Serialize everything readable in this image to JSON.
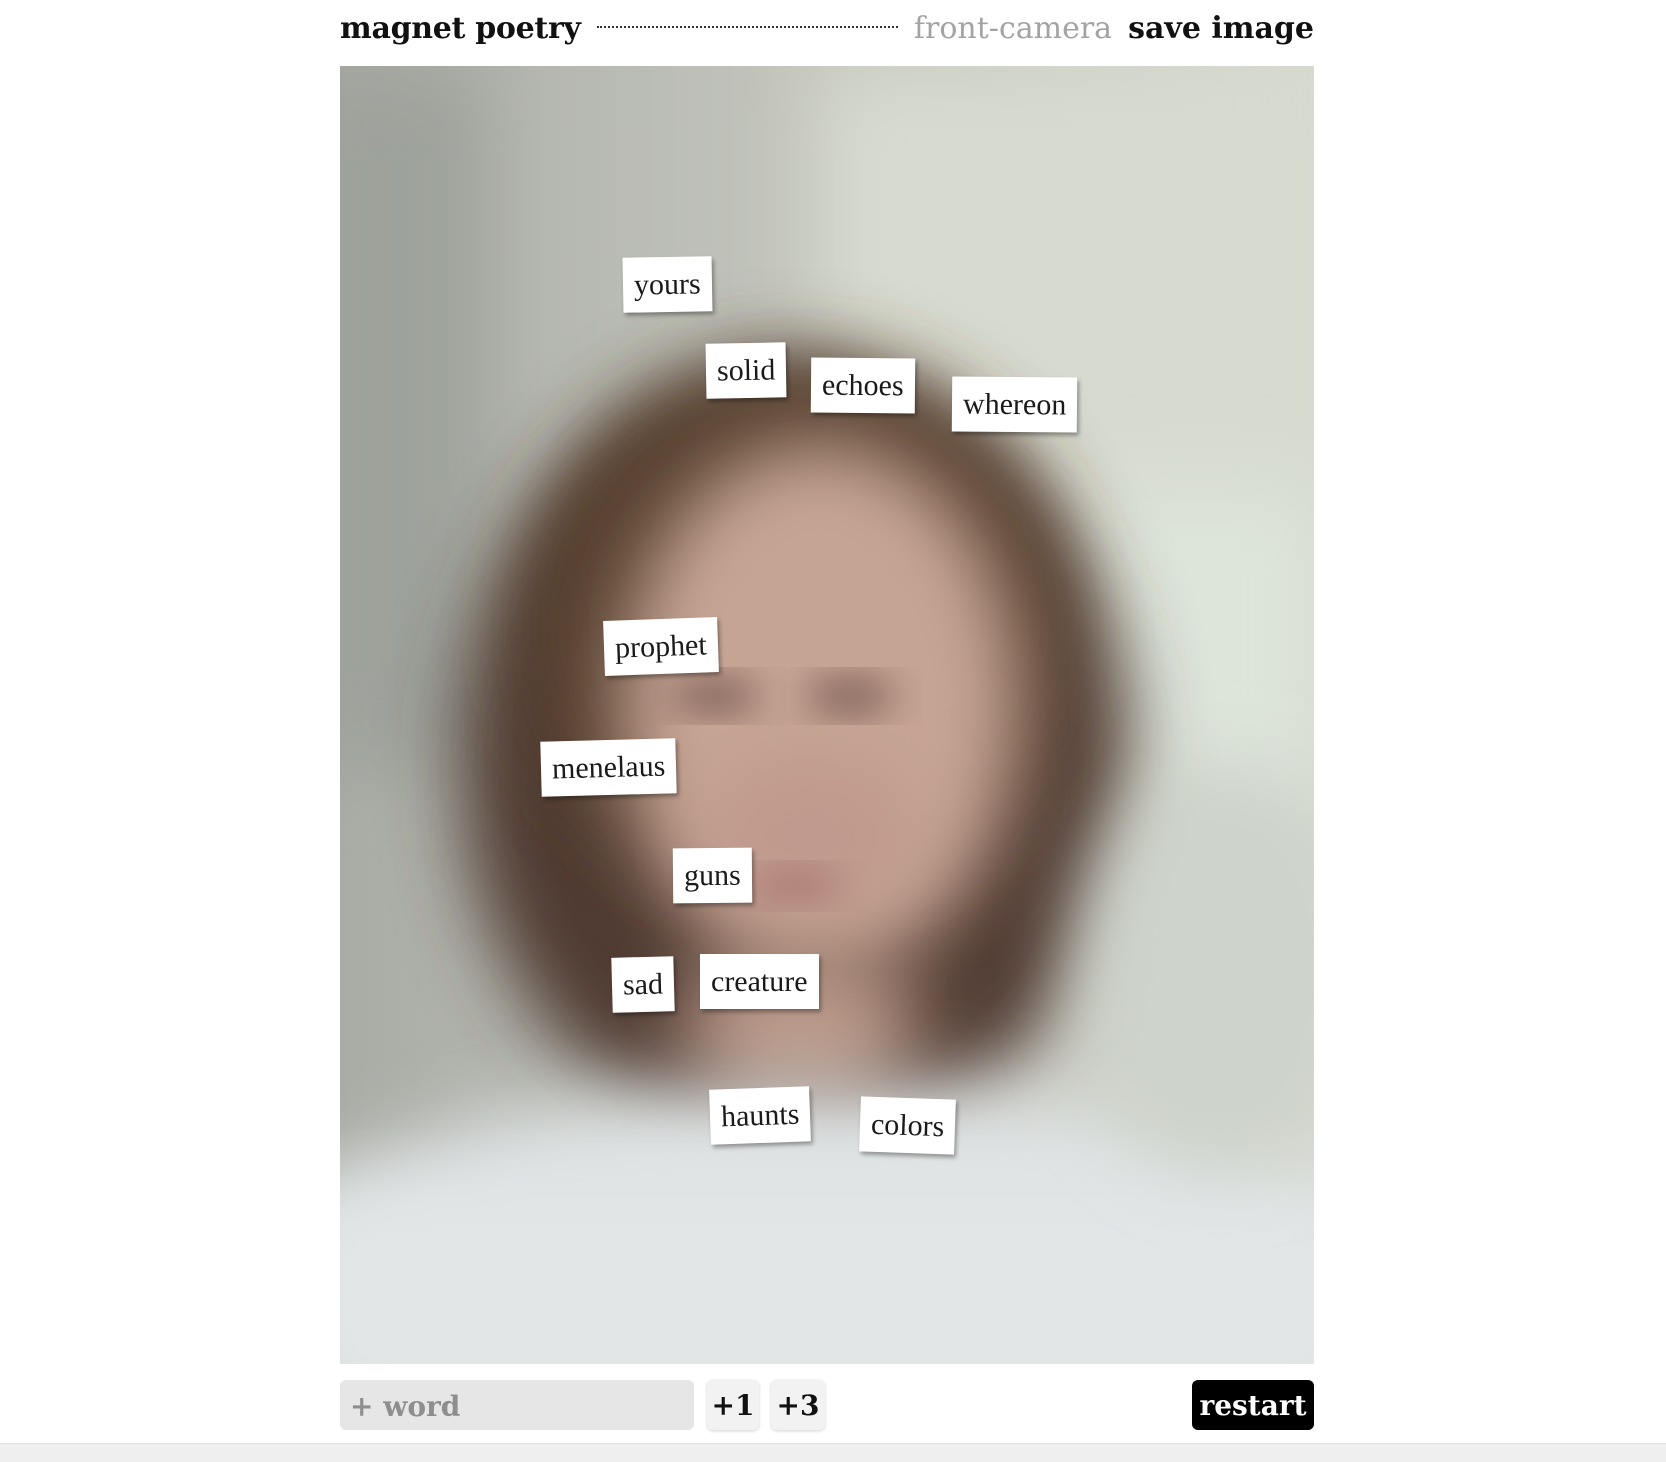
{
  "header": {
    "title": "magnet poetry",
    "camera_label": "front-camera",
    "save_label": "save image"
  },
  "tiles": [
    {
      "word": "yours"
    },
    {
      "word": "solid"
    },
    {
      "word": "echoes"
    },
    {
      "word": "whereon"
    },
    {
      "word": "prophet"
    },
    {
      "word": "menelaus"
    },
    {
      "word": "guns"
    },
    {
      "word": "sad"
    },
    {
      "word": "creature"
    },
    {
      "word": "haunts"
    },
    {
      "word": "colors"
    }
  ],
  "controls": {
    "word_placeholder": "+ word",
    "plus1_label": "+1",
    "plus3_label": "+3",
    "restart_label": "restart"
  },
  "colors": {
    "restart_bg": "#000000",
    "camera_link": "#a3a3a3",
    "input_bg": "#e6e6e6"
  }
}
